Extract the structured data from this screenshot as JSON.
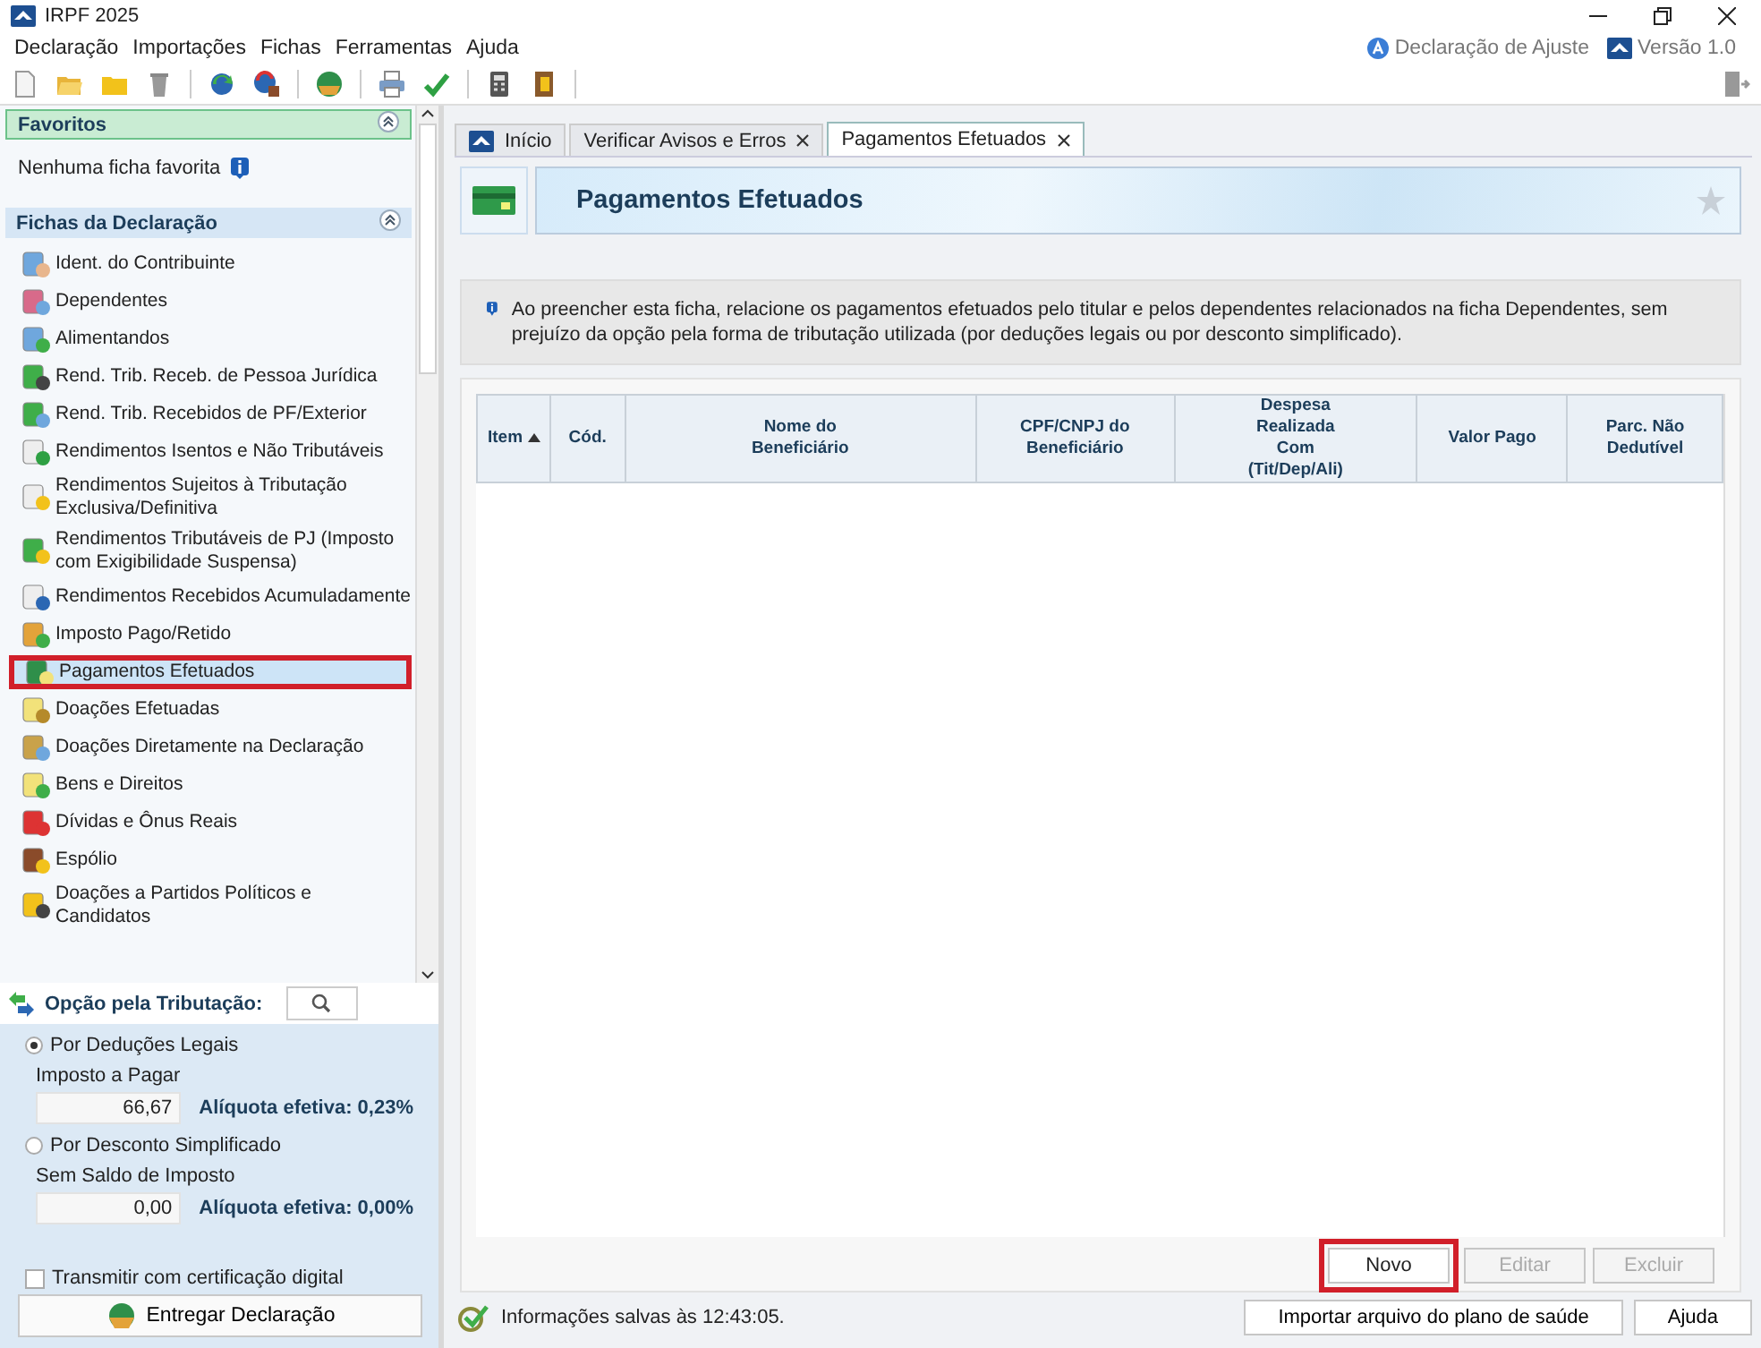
{
  "window": {
    "title": "IRPF 2025"
  },
  "menu": [
    "Declaração",
    "Importações",
    "Fichas",
    "Ferramentas",
    "Ajuda"
  ],
  "header_links": [
    {
      "label": "Declaração de Ajuste"
    },
    {
      "label": "Versão 1.0"
    }
  ],
  "favorites": {
    "title": "Favoritos",
    "expanded": true,
    "empty_text": "Nenhuma ficha favorita"
  },
  "fichas": {
    "title": "Fichas da Declaração",
    "expanded": true,
    "items": [
      {
        "label": "Ident. do Contribuinte",
        "selected": false,
        "highlighted": false
      },
      {
        "label": "Dependentes",
        "selected": false,
        "highlighted": false
      },
      {
        "label": "Alimentandos",
        "selected": false,
        "highlighted": false
      },
      {
        "label": "Rend. Trib. Receb. de Pessoa Jurídica",
        "selected": false,
        "highlighted": false
      },
      {
        "label": "Rend. Trib. Recebidos de PF/Exterior",
        "selected": false,
        "highlighted": false
      },
      {
        "label": "Rendimentos Isentos e Não Tributáveis",
        "selected": false,
        "highlighted": false
      },
      {
        "label": "Rendimentos Sujeitos à Tributação Exclusiva/Definitiva",
        "selected": false,
        "highlighted": false
      },
      {
        "label": "Rendimentos Tributáveis de PJ (Imposto com Exigibilidade Suspensa)",
        "selected": false,
        "highlighted": false
      },
      {
        "label": "Rendimentos Recebidos Acumuladamente",
        "selected": false,
        "highlighted": false
      },
      {
        "label": "Imposto Pago/Retido",
        "selected": false,
        "highlighted": false
      },
      {
        "label": "Pagamentos Efetuados",
        "selected": true,
        "highlighted": true
      },
      {
        "label": "Doações Efetuadas",
        "selected": false,
        "highlighted": false
      },
      {
        "label": "Doações Diretamente na Declaração",
        "selected": false,
        "highlighted": false
      },
      {
        "label": "Bens e Direitos",
        "selected": false,
        "highlighted": false
      },
      {
        "label": "Dívidas e Ônus Reais",
        "selected": false,
        "highlighted": false
      },
      {
        "label": "Espólio",
        "selected": false,
        "highlighted": false
      },
      {
        "label": "Doações a Partidos Políticos e Candidatos",
        "selected": false,
        "highlighted": false
      }
    ]
  },
  "tributacao": {
    "title": "Opção pela Tributação:",
    "options": [
      {
        "label": "Por Deduções Legais",
        "selected": true,
        "field_label": "Imposto a Pagar",
        "value": "66,67",
        "rate": "Alíquota efetiva: 0,23%"
      },
      {
        "label": "Por Desconto Simplificado",
        "selected": false,
        "field_label": "Sem Saldo de Imposto",
        "value": "0,00",
        "rate": "Alíquota efetiva: 0,00%"
      }
    ],
    "certificate": {
      "label": "Transmitir com certificação digital",
      "checked": false
    },
    "deliver_button": "Entregar Declaração"
  },
  "tabs": [
    {
      "label": "Início",
      "selected": false,
      "closable": false
    },
    {
      "label": "Verificar Avisos e Erros",
      "selected": false,
      "closable": true
    },
    {
      "label": "Pagamentos Efetuados",
      "selected": true,
      "closable": true
    }
  ],
  "page": {
    "title": "Pagamentos Efetuados",
    "info": "Ao preencher esta ficha, relacione os pagamentos efetuados pelo titular e pelos dependentes relacionados na ficha Dependentes, sem prejuízo da opção pela forma de tributação utilizada (por deduções legais ou por desconto simplificado).",
    "table": {
      "columns": [
        {
          "label": "Item",
          "sorted": true
        },
        {
          "label": "Cód.",
          "sorted": false
        },
        {
          "label": "Nome do\nBeneficiário",
          "sorted": false
        },
        {
          "label": "CPF/CNPJ do\nBeneficiário",
          "sorted": false
        },
        {
          "label": "Despesa\nRealizada\nCom\n(Tit/Dep/Ali)",
          "sorted": false
        },
        {
          "label": "Valor Pago",
          "sorted": false
        },
        {
          "label": "Parc. Não\nDedutível",
          "sorted": false
        }
      ]
    },
    "buttons": [
      {
        "label": "Novo",
        "disabled": false,
        "highlighted": true
      },
      {
        "label": "Editar",
        "disabled": true,
        "highlighted": false
      },
      {
        "label": "Excluir",
        "disabled": true,
        "highlighted": false
      }
    ]
  },
  "status_bar": {
    "text": "Informações salvas às 12:43:05.",
    "buttons": [
      "Importar arquivo do plano de saúde",
      "Ajuda"
    ]
  }
}
